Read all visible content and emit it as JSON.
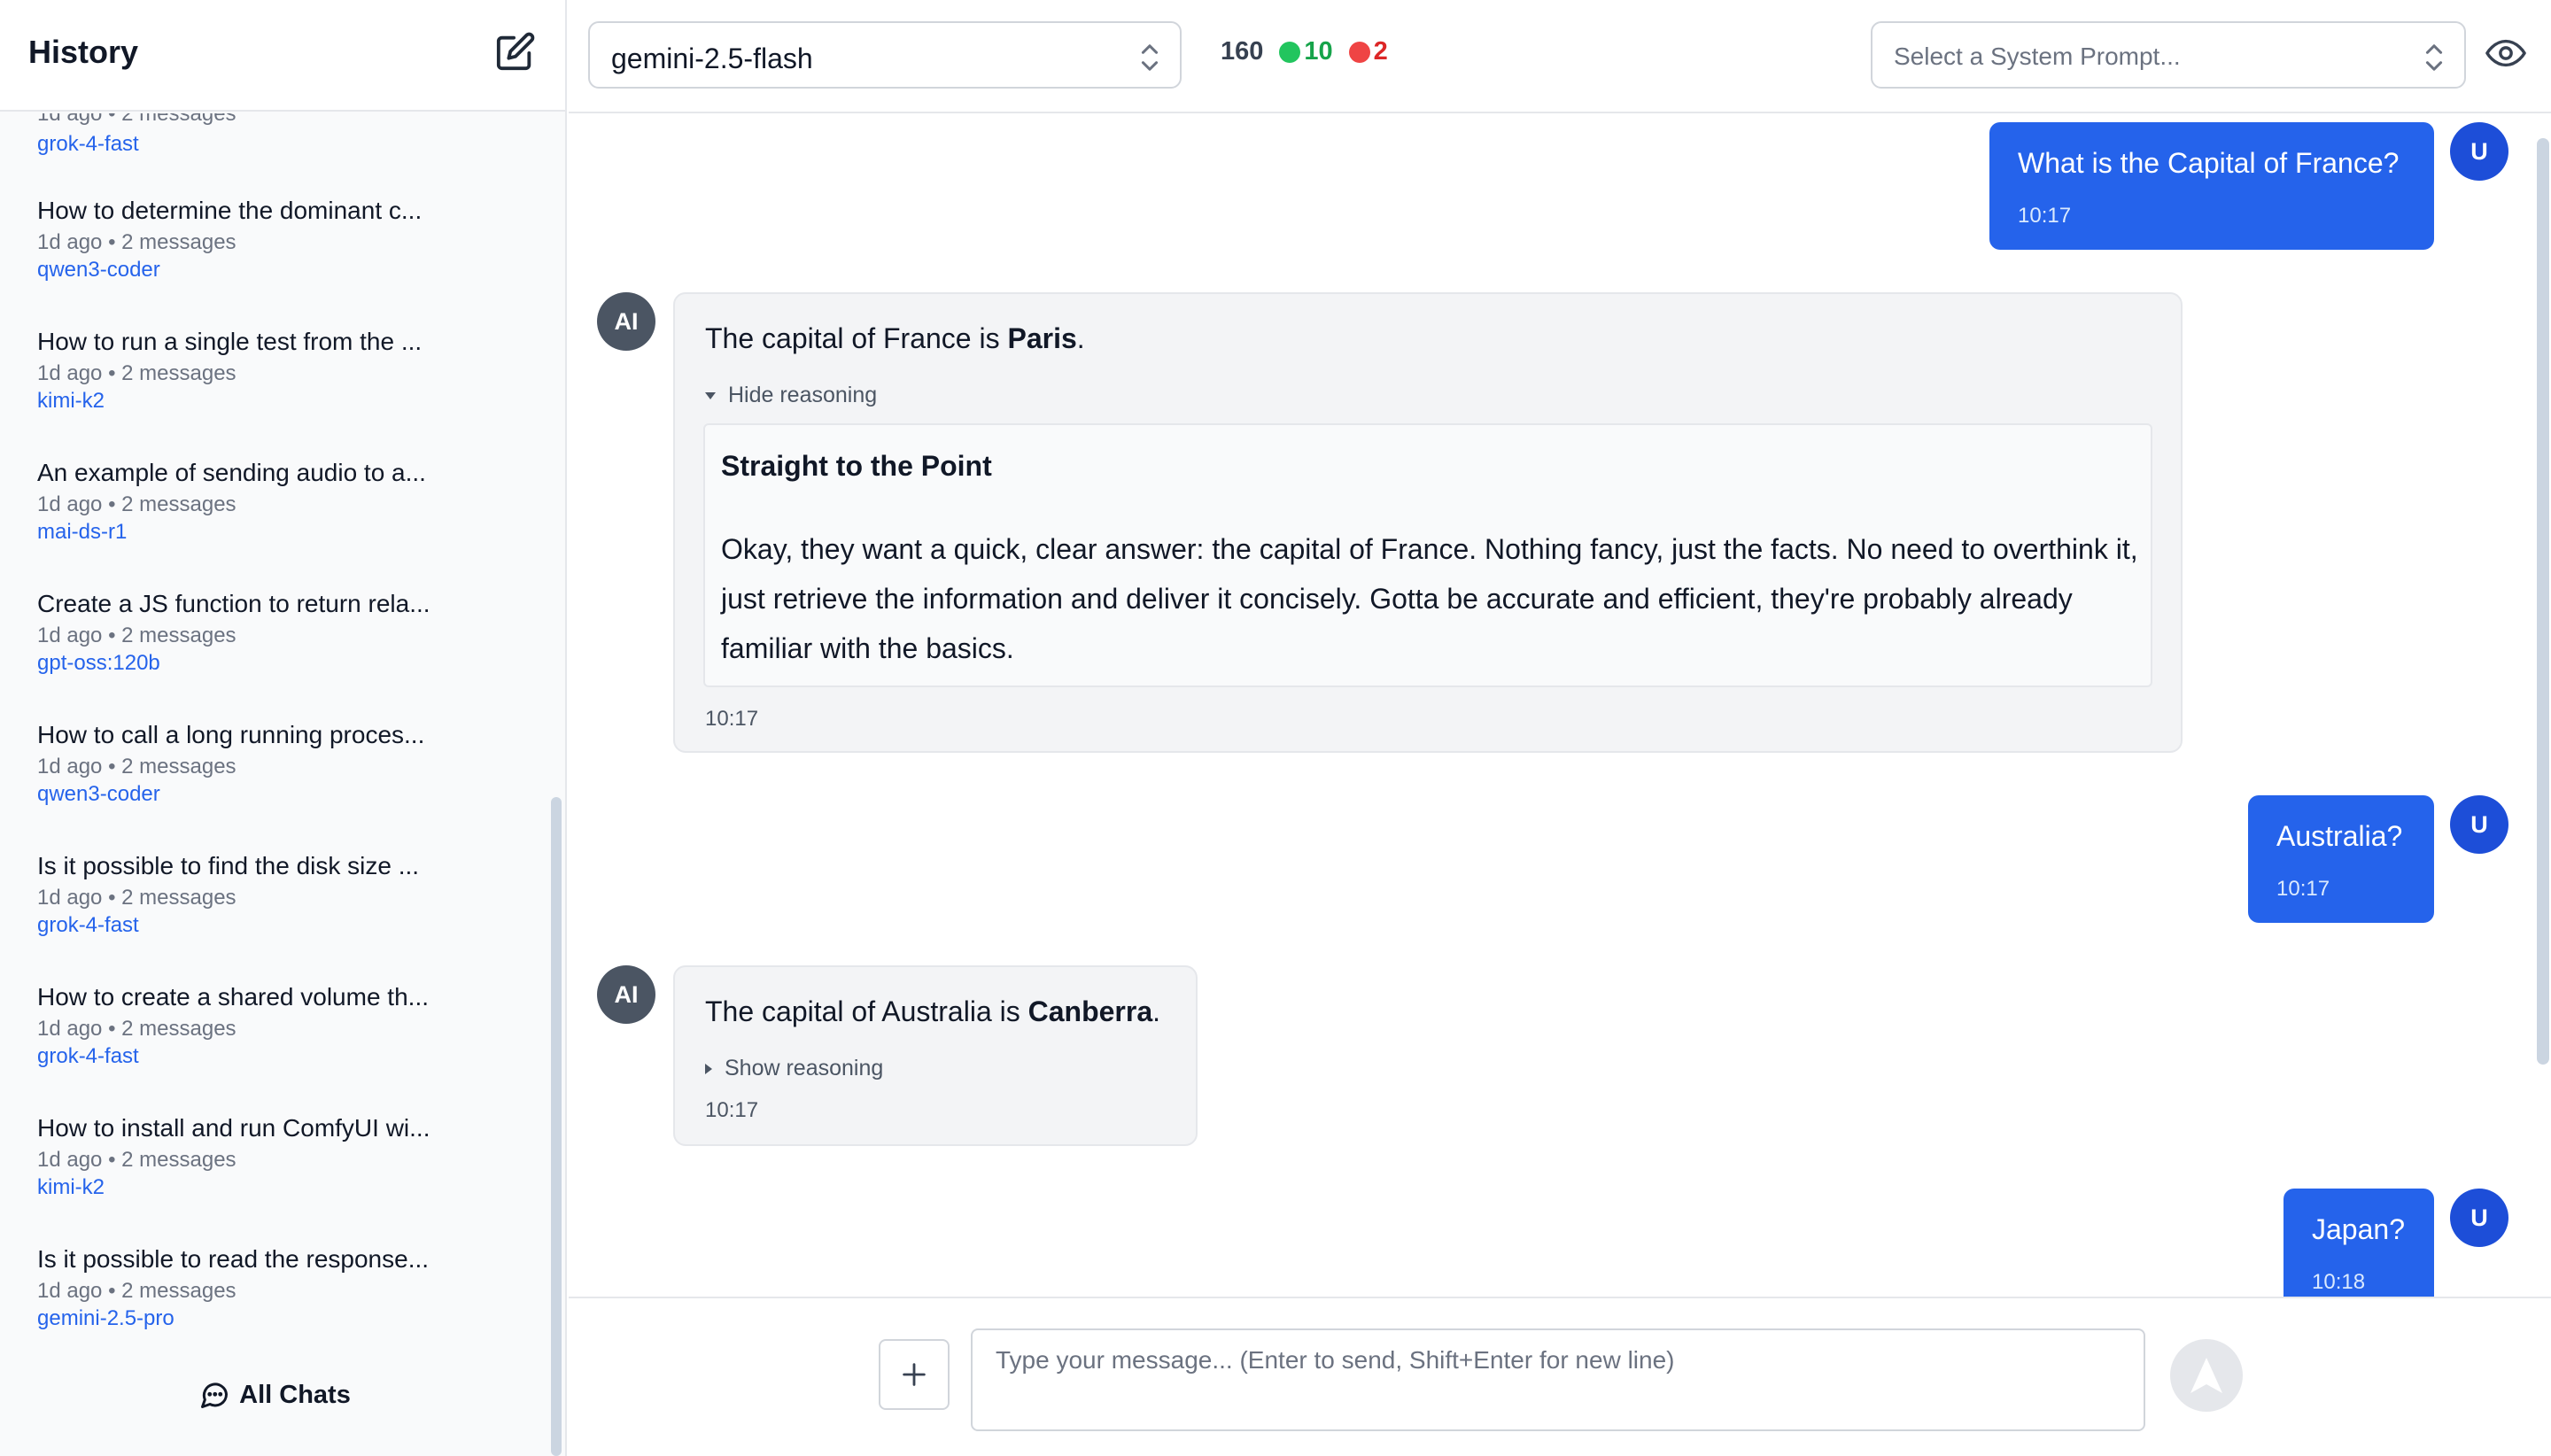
{
  "sidebar": {
    "title": "History",
    "partial_item": {
      "meta": "1d ago • 2 messages",
      "model": "grok-4-fast"
    },
    "items": [
      {
        "title": "How to determine the dominant c...",
        "meta": "1d ago • 2 messages",
        "model": "qwen3-coder"
      },
      {
        "title": "How to run a single test from the ...",
        "meta": "1d ago • 2 messages",
        "model": "kimi-k2"
      },
      {
        "title": "An example of sending audio to a...",
        "meta": "1d ago • 2 messages",
        "model": "mai-ds-r1"
      },
      {
        "title": "Create a JS function to return rela...",
        "meta": "1d ago • 2 messages",
        "model": "gpt-oss:120b"
      },
      {
        "title": "How to call a long running proces...",
        "meta": "1d ago • 2 messages",
        "model": "qwen3-coder"
      },
      {
        "title": "Is it possible to find the disk size ...",
        "meta": "1d ago • 2 messages",
        "model": "grok-4-fast"
      },
      {
        "title": "How to create a shared volume th...",
        "meta": "1d ago • 2 messages",
        "model": "grok-4-fast"
      },
      {
        "title": "How to install and run ComfyUI wi...",
        "meta": "1d ago • 2 messages",
        "model": "kimi-k2"
      },
      {
        "title": "Is it possible to read the response...",
        "meta": "1d ago • 2 messages",
        "model": "gemini-2.5-pro"
      }
    ],
    "all_chats_label": "All Chats"
  },
  "topbar": {
    "model": "gemini-2.5-flash",
    "stats": {
      "total": "160",
      "success": "10",
      "errors": "2"
    },
    "colors": {
      "success": "#22c55e",
      "error": "#ef4444"
    },
    "system_prompt_placeholder": "Select a System Prompt...",
    "eye_icon": "eye-icon"
  },
  "chat": {
    "user_avatar": "U",
    "ai_avatar": "AI",
    "messages": [
      {
        "role": "user",
        "text": "What is the Capital of France?",
        "time": "10:17"
      },
      {
        "role": "ai",
        "text_prefix": "The capital of France is ",
        "text_bold": "Paris",
        "text_suffix": ".",
        "reasoning_toggle": "Hide reasoning",
        "reasoning_title": "Straight to the Point",
        "reasoning_body": "Okay, they want a quick, clear answer: the capital of France. Nothing fancy, just the facts. No need to overthink it, just retrieve the information and deliver it concisely. Gotta be accurate and efficient, they're probably already familiar with the basics.",
        "time": "10:17"
      },
      {
        "role": "user",
        "text": "Australia?",
        "time": "10:17"
      },
      {
        "role": "ai",
        "text_prefix": "The capital of Australia is ",
        "text_bold": "Canberra",
        "text_suffix": ".",
        "reasoning_toggle": "Show reasoning",
        "time": "10:17"
      },
      {
        "role": "user",
        "text": "Japan?",
        "time": "10:18"
      }
    ]
  },
  "composer": {
    "placeholder": "Type your message... (Enter to send, Shift+Enter for new line)",
    "value": ""
  },
  "colors": {
    "accent": "#2563eb",
    "avatar_user": "#1d4ed8",
    "avatar_ai": "#4b5563"
  }
}
